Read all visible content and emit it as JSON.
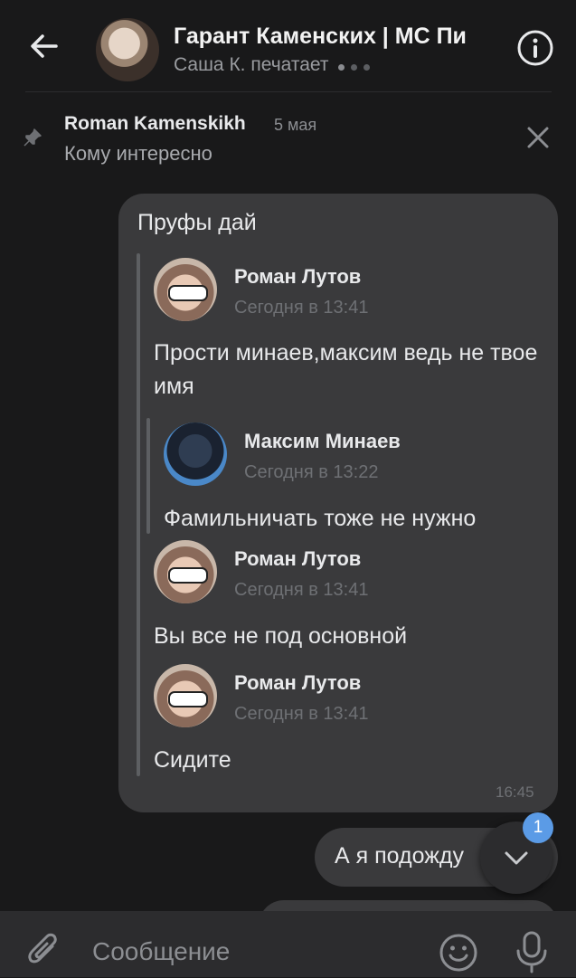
{
  "header": {
    "title": "Гарант Каменских | МС Пи",
    "subtitle": "Саша К. печатает",
    "back_icon": "arrow-left-icon",
    "info_icon": "info-icon"
  },
  "pinned": {
    "author": "Roman Kamenskikh",
    "date": "5 мая",
    "text": "Кому интересно"
  },
  "message": {
    "text": "Пруфы дай",
    "time": "16:45",
    "forwarded": [
      {
        "name": "Роман Лутов",
        "time": "Сегодня в 13:41",
        "text": "Прости минаев,максим ведь не твое имя",
        "nested": {
          "name": "Максим Минаев",
          "time": "Сегодня в 13:22",
          "text": "Фамильничать тоже не нужно"
        }
      },
      {
        "name": "Роман Лутов",
        "time": "Сегодня в 13:41",
        "text": "Вы все не под основной"
      },
      {
        "name": "Роман Лутов",
        "time": "Сегодня в 13:41",
        "text": "Сидите"
      }
    ]
  },
  "message2": {
    "text": "А я подожду"
  },
  "scroll_down": {
    "badge": "1"
  },
  "composer": {
    "placeholder": "Сообщение"
  },
  "colors": {
    "accent": "#5b9be6",
    "bubble": "#3a3a3c",
    "background": "#19191a"
  }
}
